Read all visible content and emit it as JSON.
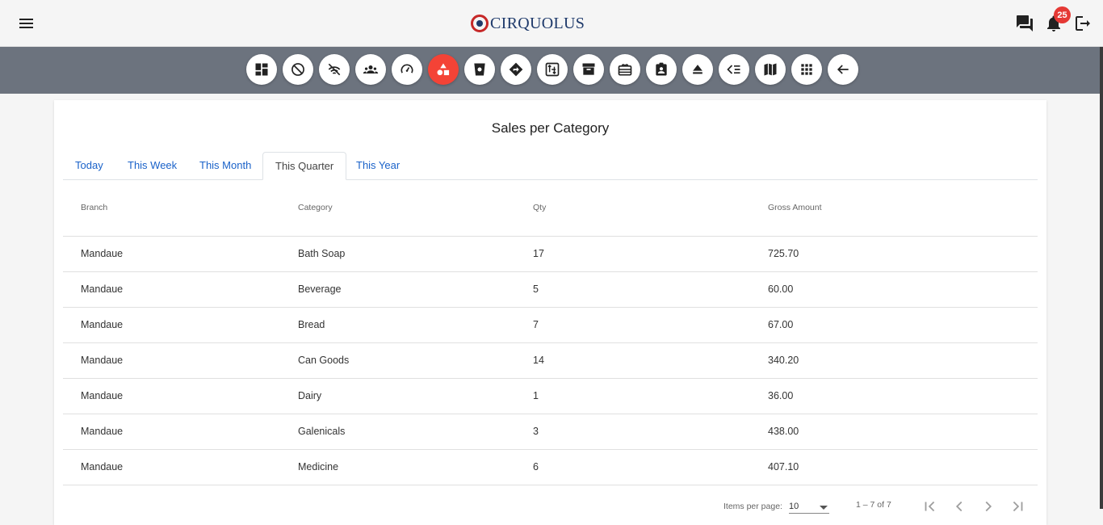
{
  "header": {
    "logo_text": "CIRQUOLUS",
    "notification_count": "25",
    "icons": [
      "menu-icon",
      "chat-icon",
      "bell-icon",
      "logout-icon"
    ]
  },
  "toolbar": {
    "active_color": "#f44336",
    "buttons": [
      {
        "name": "dashboard-icon"
      },
      {
        "name": "block-icon"
      },
      {
        "name": "wifi-off-icon"
      },
      {
        "name": "groups-icon"
      },
      {
        "name": "speedometer-icon"
      },
      {
        "name": "category-icon",
        "active": true
      },
      {
        "name": "cup-icon"
      },
      {
        "name": "directions-icon"
      },
      {
        "name": "swap-icon"
      },
      {
        "name": "archive-icon"
      },
      {
        "name": "giftcard-icon"
      },
      {
        "name": "badge-icon"
      },
      {
        "name": "eject-icon"
      },
      {
        "name": "list-icon"
      },
      {
        "name": "map-icon"
      },
      {
        "name": "apps-icon"
      },
      {
        "name": "back-arrow-icon"
      }
    ]
  },
  "report": {
    "title": "Sales per Category",
    "tabs": [
      "Today",
      "This Week",
      "This Month",
      "This Quarter",
      "This Year"
    ],
    "active_tab": "This Quarter",
    "columns": [
      "Branch",
      "Category",
      "Qty",
      "Gross Amount"
    ],
    "rows": [
      [
        "Mandaue",
        "Bath Soap",
        "17",
        "725.70"
      ],
      [
        "Mandaue",
        "Beverage",
        "5",
        "60.00"
      ],
      [
        "Mandaue",
        "Bread",
        "7",
        "67.00"
      ],
      [
        "Mandaue",
        "Can Goods",
        "14",
        "340.20"
      ],
      [
        "Mandaue",
        "Dairy",
        "1",
        "36.00"
      ],
      [
        "Mandaue",
        "Galenicals",
        "3",
        "438.00"
      ],
      [
        "Mandaue",
        "Medicine",
        "6",
        "407.10"
      ]
    ]
  },
  "paginator": {
    "items_per_page_label": "Items per page:",
    "items_per_page": "10",
    "range": "1 – 7 of 7"
  }
}
